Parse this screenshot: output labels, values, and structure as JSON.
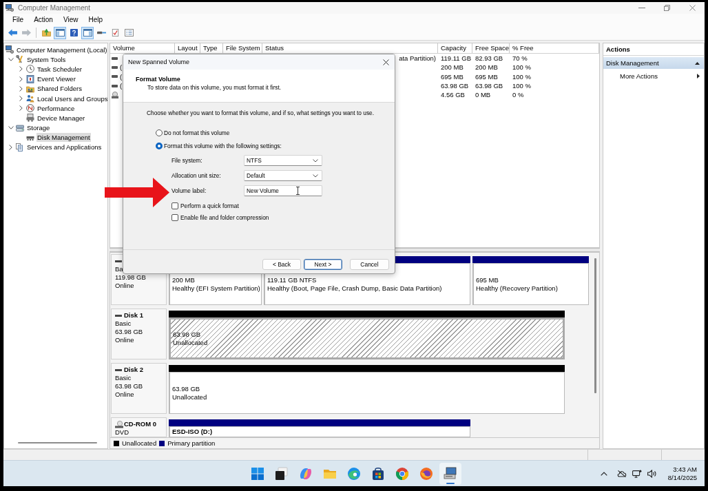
{
  "window": {
    "title": "Computer Management"
  },
  "menu": [
    "File",
    "Action",
    "View",
    "Help"
  ],
  "toolbar": {
    "groups": [
      [
        {
          "kind": "back",
          "on": false,
          "disabled": false
        },
        {
          "kind": "forward",
          "on": false,
          "disabled": true
        }
      ],
      [
        {
          "kind": "up",
          "on": false,
          "disabled": false
        },
        {
          "kind": "tree",
          "on": true,
          "disabled": false
        },
        {
          "kind": "help",
          "on": false,
          "disabled": false
        },
        {
          "kind": "pane",
          "on": true,
          "disabled": false
        },
        {
          "kind": "connect",
          "on": false,
          "disabled": false
        },
        {
          "kind": "properties",
          "on": false,
          "disabled": false
        },
        {
          "kind": "export",
          "on": false,
          "disabled": false
        }
      ]
    ]
  },
  "tree": {
    "items": [
      {
        "label": "Computer Management (Local)",
        "kind": "computer",
        "selected": false,
        "children": [
          {
            "label": "System Tools",
            "kind": "tools",
            "expanded": true,
            "selected": false,
            "children": [
              {
                "label": "Task Scheduler",
                "kind": "scheduler",
                "expanded": false,
                "selected": false
              },
              {
                "label": "Event Viewer",
                "kind": "events",
                "expanded": false,
                "selected": false
              },
              {
                "label": "Shared Folders",
                "kind": "shares",
                "expanded": false,
                "selected": false
              },
              {
                "label": "Local Users and Groups",
                "kind": "users",
                "expanded": false,
                "selected": false
              },
              {
                "label": "Performance",
                "kind": "performance",
                "expanded": false,
                "selected": false
              },
              {
                "label": "Device Manager",
                "kind": "devices",
                "selected": false
              }
            ]
          },
          {
            "label": "Storage",
            "kind": "storage",
            "expanded": true,
            "selected": false,
            "children": [
              {
                "label": "Disk Management",
                "kind": "disk",
                "selected": true
              }
            ]
          },
          {
            "label": "Services and Applications",
            "kind": "services",
            "expanded": false,
            "selected": false
          }
        ]
      }
    ]
  },
  "volumes": {
    "columns": [
      "Volume",
      "Layout",
      "Type",
      "File System",
      "Status",
      "Capacity",
      "Free Space",
      "% Free"
    ],
    "rows": [
      {
        "kind": "disk",
        "status": "ata Partition)",
        "capacity": "119.11 GB",
        "free_space": "82.93 GB",
        "percent_free": "70 %"
      },
      {
        "kind": "disk",
        "volume": "(",
        "capacity": "200 MB",
        "free_space": "200 MB",
        "percent_free": "100 %"
      },
      {
        "kind": "disk",
        "volume": "(",
        "capacity": "695 MB",
        "free_space": "695 MB",
        "percent_free": "100 %"
      },
      {
        "kind": "disk",
        "volume": "(",
        "capacity": "63.98 GB",
        "free_space": "63.98 GB",
        "percent_free": "100 %"
      },
      {
        "kind": "cd",
        "capacity": "4.56 GB",
        "free_space": "0 MB",
        "percent_free": "0 %"
      }
    ]
  },
  "disks": [
    {
      "kind": "disk",
      "type": "Ba",
      "size": "119.98 GB",
      "status": "Online",
      "partitions": [
        {
          "kind": "primary",
          "size": "200 MB",
          "status": "Healthy (EFI System Partition)",
          "selected": false
        },
        {
          "kind": "primary",
          "size": "119.11 GB NTFS",
          "status": "Healthy (Boot, Page File, Crash Dump, Basic Data Partition)",
          "selected": false
        },
        {
          "kind": "primary",
          "size": "695 MB",
          "status": "Healthy (Recovery Partition)",
          "selected": false
        }
      ]
    },
    {
      "kind": "disk",
      "name": "Disk 1",
      "type": "Basic",
      "size": "63.98 GB",
      "status": "Online",
      "partitions": [
        {
          "kind": "unallocated",
          "size": "63.98 GB",
          "status": "Unallocated",
          "selected": true
        }
      ]
    },
    {
      "kind": "disk",
      "name": "Disk 2",
      "type": "Basic",
      "size": "63.98 GB",
      "status": "Online",
      "partitions": [
        {
          "kind": "unallocated",
          "size": "63.98 GB",
          "status": "Unallocated",
          "selected": false
        }
      ]
    },
    {
      "kind": "cdrom",
      "name": "CD-ROM 0",
      "type": "DVD",
      "partitions": [
        {
          "kind": "primary",
          "label": "ESD-ISO (D:)",
          "selected": false
        }
      ]
    }
  ],
  "legend": [
    {
      "label": "Unallocated",
      "color": "#000000"
    },
    {
      "label": "Primary partition",
      "color": "#000080"
    }
  ],
  "actions": {
    "title": "Actions",
    "items": [
      {
        "kind": "section",
        "label": "Disk Management",
        "expanded": true
      },
      {
        "kind": "link",
        "label": "More Actions"
      }
    ]
  },
  "dialog": {
    "title": "New Spanned Volume",
    "heading": "Format Volume",
    "subheading": "To store data on this volume, you must format it first.",
    "instruction": "Choose whether you want to format this volume, and if so, what settings you want to use.",
    "options": [
      {
        "label": "Do not format this volume",
        "selected": false
      },
      {
        "label": "Format this volume with the following settings:",
        "selected": true
      }
    ],
    "fields": [
      {
        "kind": "select",
        "label": "File system:",
        "value": "NTFS"
      },
      {
        "kind": "select",
        "label": "Allocation unit size:",
        "value": "Default"
      },
      {
        "kind": "text",
        "label": "Volume label:",
        "value": "New Volume"
      }
    ],
    "checkboxes": [
      {
        "label": "Perform a quick format",
        "checked": false
      },
      {
        "label": "Enable file and folder compression",
        "checked": false
      }
    ],
    "buttons": [
      {
        "label": "< Back",
        "focused": false
      },
      {
        "label": "Next >",
        "focused": true
      },
      {
        "label": "Cancel",
        "focused": false
      }
    ]
  },
  "taskbar": {
    "apps": [
      {
        "kind": "start",
        "active": false
      },
      {
        "kind": "task_view",
        "active": false
      },
      {
        "kind": "assistant",
        "active": false
      },
      {
        "kind": "files",
        "active": false
      },
      {
        "kind": "browser_wave",
        "active": false
      },
      {
        "kind": "store",
        "active": false
      },
      {
        "kind": "browser_ring",
        "active": false
      },
      {
        "kind": "browser_fox",
        "active": false
      },
      {
        "kind": "admin_tool",
        "active": true
      }
    ],
    "clock": {
      "time": "3:43 AM",
      "date": "8/14/2025"
    }
  }
}
